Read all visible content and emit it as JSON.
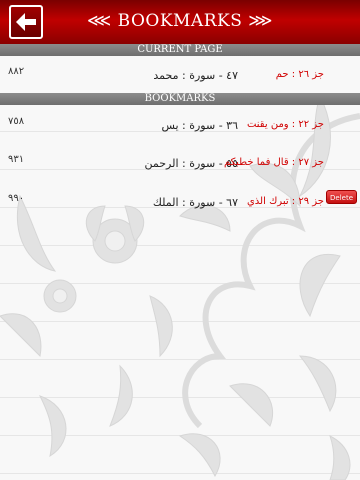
{
  "header": {
    "title": "⋘ BOOKMARKS ⋙",
    "back_icon": "arrow-left-icon"
  },
  "current_section": {
    "label": "CURRENT PAGE",
    "item": {
      "page": "٨٨٢",
      "juz": "جز ٢٦ : حم",
      "surah": "٤٧ - سورة : محمد"
    }
  },
  "bookmarks_section": {
    "label": "BOOKMARKS",
    "items": [
      {
        "page": "٧٥٨",
        "juz": "جز ٢٢ : ومن يقنت",
        "surah": "٣٦ - سورة : يس"
      },
      {
        "page": "٩٣١",
        "juz": "جز ٢٧ : قال فما خطبكم",
        "surah": "٥٥ - سورة : الرحمن"
      },
      {
        "page": "٩٩٠",
        "juz": "جز ٢٩ : تبرك الذي",
        "surah": "٦٧ - سورة : الملك",
        "delete_label": "Delete"
      }
    ]
  },
  "colors": {
    "header_red": "#c00000",
    "juz_text": "#d00000",
    "section_bar": "#7a7a7a"
  }
}
